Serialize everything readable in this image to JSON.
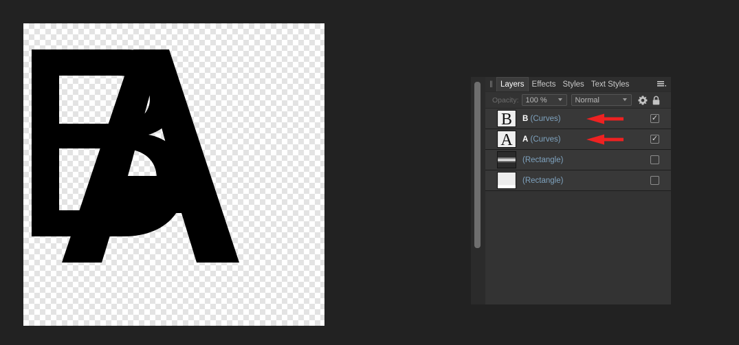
{
  "app": {
    "background_color": "#222222",
    "canvas_background": "transparency-checkerboard"
  },
  "canvas": {
    "name": "document-canvas",
    "artwork_description": "Overlapping black letterforms B and A on a transparent checkerboard background",
    "letters": [
      "B",
      "A"
    ],
    "fill_color": "#000000",
    "checker_light": "#ffffff",
    "checker_dark": "#e3e3e3"
  },
  "panel": {
    "title": "Layers",
    "grip_glyph": "||",
    "menu_icon": "hamburger-menu-icon",
    "menu_glyph": "☰",
    "tabs": [
      {
        "label": "Layers",
        "active": true
      },
      {
        "label": "Effects",
        "active": false
      },
      {
        "label": "Styles",
        "active": false
      },
      {
        "label": "Text Styles",
        "active": false
      }
    ],
    "options": {
      "opacity_label": "Opacity:",
      "opacity_value": "100 %",
      "blend_mode_value": "Normal",
      "gear_icon": "gear-icon",
      "lock_icon": "lock-icon",
      "dropdown_arrow": "▼"
    },
    "colors": {
      "panel_bg": "#333333",
      "row_bg": "#383838",
      "tab_active_bg": "#3c3c3c",
      "layer_type_text": "#7fa3bf",
      "layer_name_text": "#ffffff",
      "annotation_red": "#ee2222"
    },
    "layers": [
      {
        "letter": "B",
        "type_label": "(Curves)",
        "full_label": "B (Curves)",
        "visible": true,
        "checkbox_glyph": "✓",
        "thumbnail": "letter-b-thumbnail",
        "annotated": true
      },
      {
        "letter": "A",
        "type_label": "(Curves)",
        "full_label": "A (Curves)",
        "visible": true,
        "checkbox_glyph": "✓",
        "thumbnail": "letter-a-thumbnail",
        "annotated": true
      },
      {
        "letter": "",
        "type_label": "(Rectangle)",
        "full_label": "(Rectangle)",
        "visible": false,
        "checkbox_glyph": "",
        "thumbnail": "dark-stripe-thumbnail",
        "annotated": false
      },
      {
        "letter": "",
        "type_label": "(Rectangle)",
        "full_label": "(Rectangle)",
        "visible": false,
        "checkbox_glyph": "",
        "thumbnail": "light-rectangle-thumbnail",
        "annotated": false
      }
    ],
    "scrollbar": {
      "name": "panel-vertical-scrollbar",
      "thumb_color": "#6e6e6e"
    }
  }
}
